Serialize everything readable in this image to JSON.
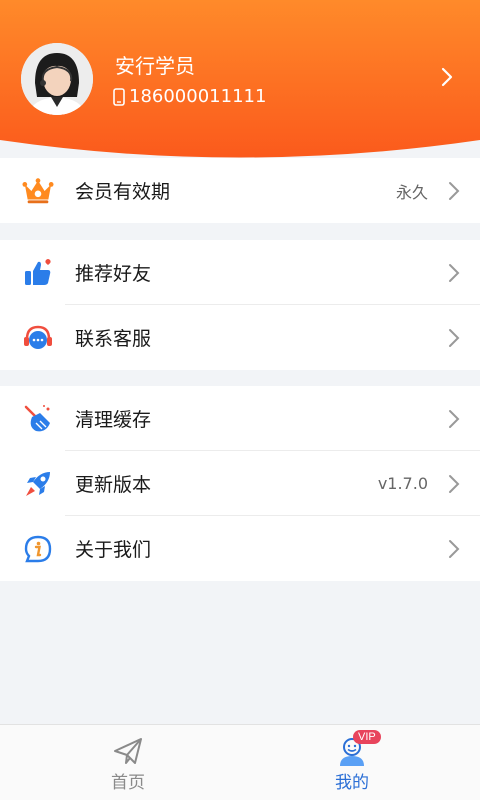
{
  "colors": {
    "accent": "#ff7a1a",
    "header_top": "#ff8a2a",
    "header_bottom": "#fb5f1e",
    "tab_active": "#2b6fd6",
    "tab_inactive": "#8a8a8a",
    "badge": "#e8445c"
  },
  "profile": {
    "name": "安行学员",
    "phone": "186000011111",
    "avatar_icon": "user-avatar-photo"
  },
  "groups": [
    {
      "items": [
        {
          "icon": "crown-icon",
          "label": "会员有效期",
          "value": "永久"
        }
      ]
    },
    {
      "items": [
        {
          "icon": "thumbs-up-icon",
          "label": "推荐好友",
          "value": ""
        },
        {
          "icon": "headset-chat-icon",
          "label": "联系客服",
          "value": ""
        }
      ]
    },
    {
      "items": [
        {
          "icon": "broom-icon",
          "label": "清理缓存",
          "value": ""
        },
        {
          "icon": "rocket-icon",
          "label": "更新版本",
          "value": "v1.7.0"
        },
        {
          "icon": "info-icon",
          "label": "关于我们",
          "value": ""
        }
      ]
    }
  ],
  "tabbar": {
    "tabs": [
      {
        "icon": "paper-plane-icon",
        "label": "首页",
        "active": false
      },
      {
        "icon": "user-vip-icon",
        "label": "我的",
        "active": true,
        "badge": "VIP"
      }
    ]
  }
}
